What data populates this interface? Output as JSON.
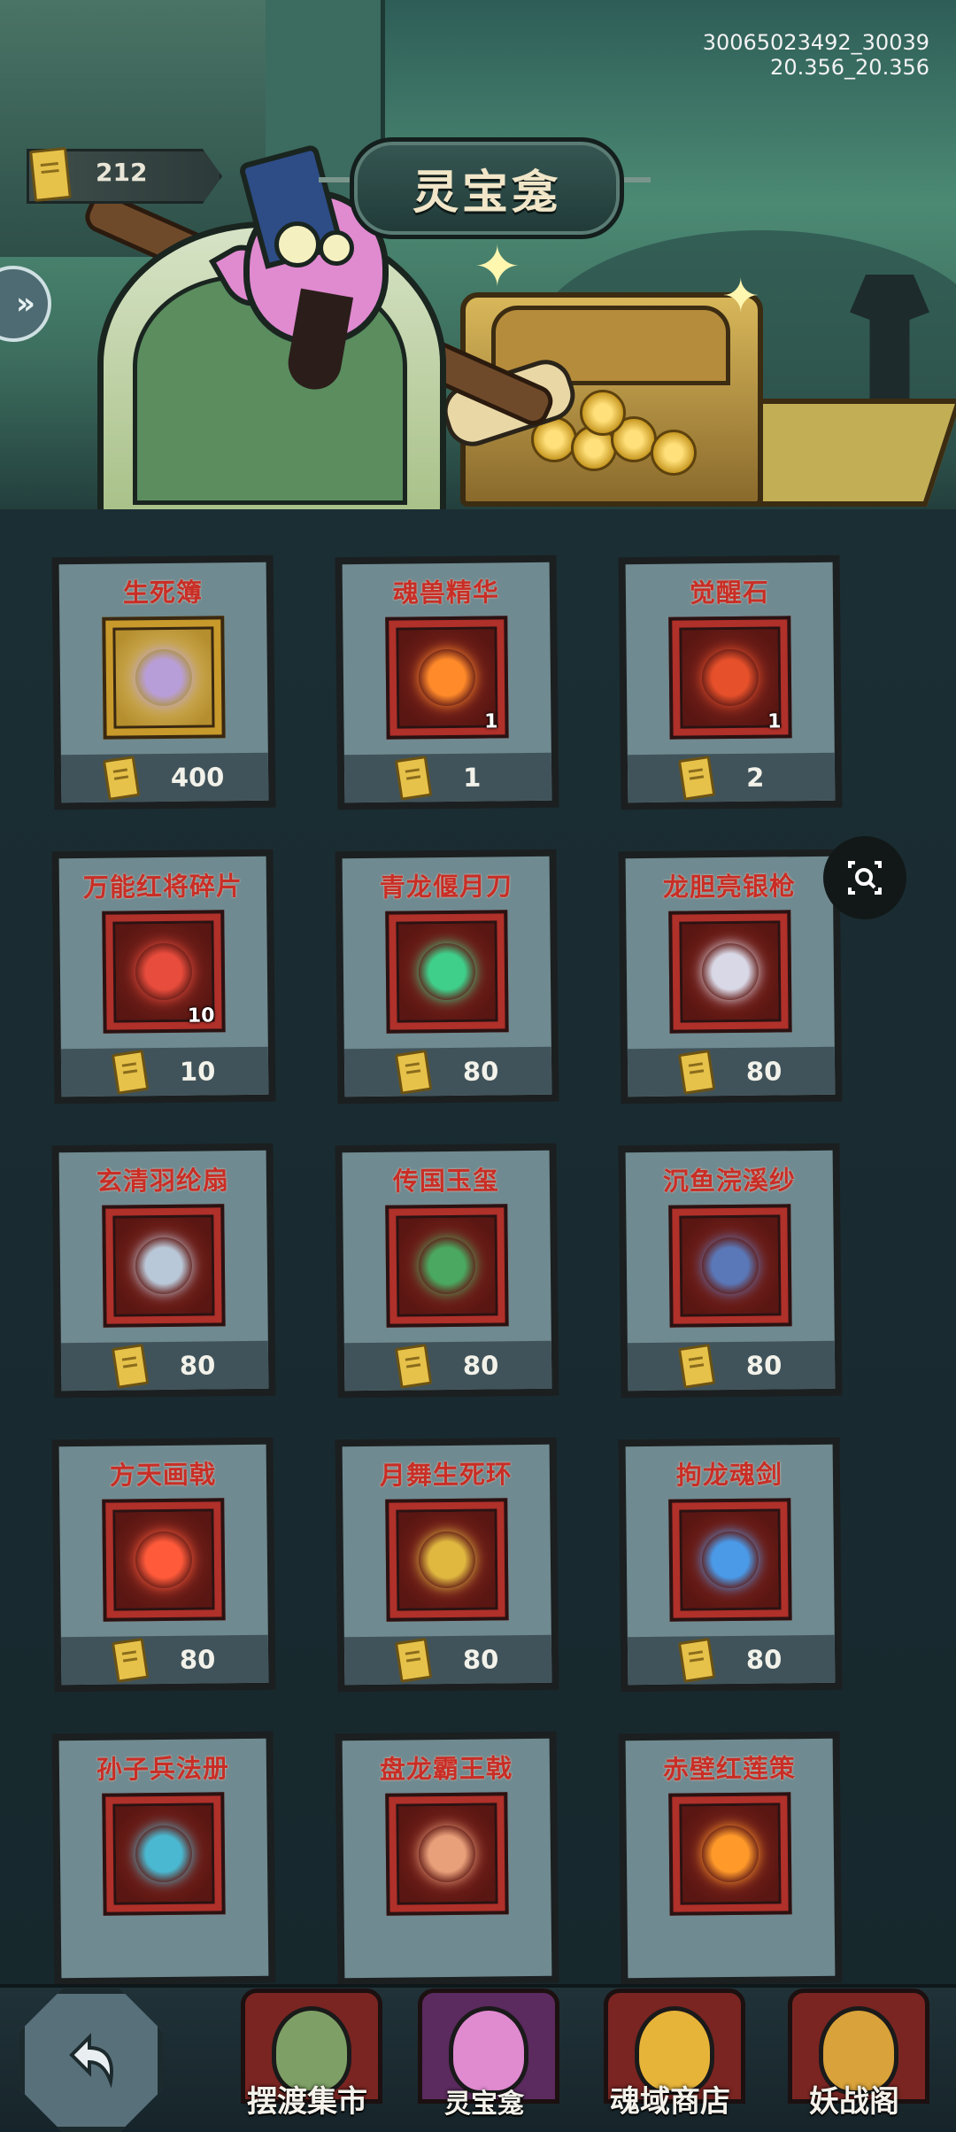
{
  "header": {
    "title": "灵宝龛",
    "ids_line1": "30065023492_30039",
    "ids_line2": "20.356_20.356",
    "currency_icon": "ticket-icon",
    "currency_value": "212",
    "side_tab_icon": "double-chevron-right-icon"
  },
  "colors": {
    "name_red": "#c82e26",
    "card_bg": "#6f8a90",
    "price_bar": "#41535a",
    "frame_red": "#b0302a",
    "frame_gold": "#c89a2c"
  },
  "items": [
    {
      "name": "生死簿",
      "qty": "",
      "price": "400",
      "icon": "book-icon"
    },
    {
      "name": "魂兽精华",
      "qty": "1",
      "price": "1",
      "icon": "fire-orb-icon"
    },
    {
      "name": "觉醒石",
      "qty": "1",
      "price": "2",
      "icon": "gem-icon"
    },
    {
      "name": "万能红将碎片",
      "qty": "10",
      "price": "10",
      "icon": "hero-shard-icon"
    },
    {
      "name": "青龙偃月刀",
      "qty": "",
      "price": "80",
      "icon": "glaive-icon"
    },
    {
      "name": "龙胆亮银枪",
      "qty": "",
      "price": "80",
      "icon": "spear-icon"
    },
    {
      "name": "玄清羽纶扇",
      "qty": "",
      "price": "80",
      "icon": "fan-icon"
    },
    {
      "name": "传国玉玺",
      "qty": "",
      "price": "80",
      "icon": "seal-icon"
    },
    {
      "name": "沉鱼浣溪纱",
      "qty": "",
      "price": "80",
      "icon": "veil-icon"
    },
    {
      "name": "方天画戟",
      "qty": "",
      "price": "80",
      "icon": "halberd-icon"
    },
    {
      "name": "月舞生死环",
      "qty": "",
      "price": "80",
      "icon": "ring-blade-icon"
    },
    {
      "name": "拘龙魂剑",
      "qty": "",
      "price": "80",
      "icon": "sword-icon"
    },
    {
      "name": "孙子兵法册",
      "qty": "",
      "price": "",
      "icon": "scroll-icon"
    },
    {
      "name": "盘龙霸王戟",
      "qty": "",
      "price": "",
      "icon": "dragon-halberd-icon"
    },
    {
      "name": "赤壁红莲策",
      "qty": "",
      "price": "",
      "icon": "fire-book-icon"
    }
  ],
  "nav": {
    "back_icon": "back-arrow-icon",
    "items": [
      {
        "label": "摆渡集市"
      },
      {
        "label": "灵宝龛"
      },
      {
        "label": "魂域商店"
      },
      {
        "label": "妖战阁"
      }
    ]
  },
  "overlay": {
    "lens_icon": "lens-search-icon"
  }
}
